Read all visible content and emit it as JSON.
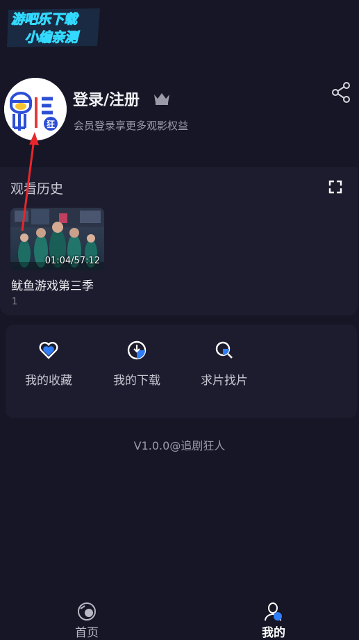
{
  "watermark": {
    "line1": "游吧乐下载",
    "line2": "小编亲测"
  },
  "profile": {
    "username": "登录/注册",
    "subtitle": "会员登录享更多观影权益",
    "avatar_badge": "狂"
  },
  "history": {
    "title": "观看历史",
    "items": [
      {
        "title": "鱿鱼游戏第三季",
        "progress": "01:04/57:12",
        "episode": "1"
      }
    ]
  },
  "tools": {
    "favorites": "我的收藏",
    "downloads": "我的下载",
    "request": "求片找片"
  },
  "version": "V1.0.0@追剧狂人",
  "tabbar": {
    "home": "首页",
    "mine": "我的"
  },
  "colors": {
    "background": "#161626",
    "card": "#1c1c2e",
    "accent": "#2f7cf6",
    "active_tab": "#ffffff",
    "inactive_tab": "#b8b8c4",
    "annotation": "#e8262b"
  }
}
